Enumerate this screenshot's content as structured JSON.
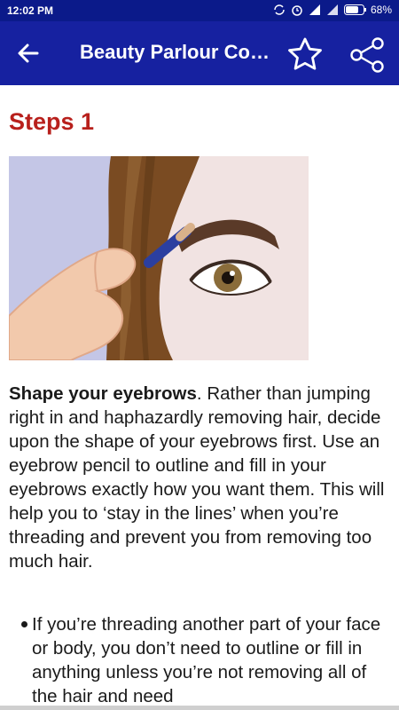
{
  "status_bar": {
    "time": "12:02 PM",
    "battery": "68%"
  },
  "app_bar": {
    "title": "Beauty Parlour Course"
  },
  "article": {
    "heading": "Steps 1",
    "paragraph_bold": "Shape your eyebrows",
    "paragraph_text": ". Rather than jumping right in and haphazardly removing hair, decide upon the shape of your eyebrows first. Use an eyebrow pencil to outline and fill in your eyebrows exactly how you want them. This will help you to ‘stay in the lines’ when you’re threading and prevent you from removing too much hair.",
    "bullet_text": "If you’re threading another part of your face or body, you don’t need to outline or fill in anything unless you’re not removing all of the hair and need"
  },
  "colors": {
    "status_bar_bg": "#0b1a8a",
    "app_bar_bg": "#1621a0",
    "heading_color": "#b8201c"
  },
  "icons": [
    "back-arrow-icon",
    "star-icon",
    "share-icon",
    "alarm-icon",
    "signal-icon",
    "wifi-icon",
    "battery-icon"
  ]
}
